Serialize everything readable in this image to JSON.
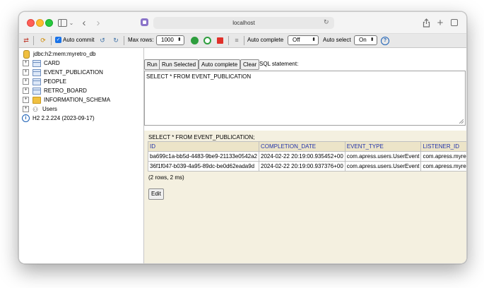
{
  "browser": {
    "url": "localhost"
  },
  "toolbar": {
    "auto_commit_label": "Auto commit",
    "max_rows_label": "Max rows:",
    "max_rows_value": "1000",
    "auto_complete_label": "Auto complete",
    "auto_complete_value": "Off",
    "auto_select_label": "Auto select",
    "auto_select_value": "On",
    "help_glyph": "?"
  },
  "tree": {
    "connection": "jdbc:h2:mem:myretro_db",
    "items": [
      {
        "label": "CARD",
        "icon": "table-icon"
      },
      {
        "label": "EVENT_PUBLICATION",
        "icon": "table-icon"
      },
      {
        "label": "PEOPLE",
        "icon": "table-icon"
      },
      {
        "label": "RETRO_BOARD",
        "icon": "table-icon"
      },
      {
        "label": "INFORMATION_SCHEMA",
        "icon": "folder-icon"
      },
      {
        "label": "Users",
        "icon": "users-icon"
      }
    ],
    "version": "H2 2.2.224 (2023-09-17)"
  },
  "query": {
    "run": "Run",
    "run_selected": "Run Selected",
    "auto_complete": "Auto complete",
    "clear": "Clear",
    "sql_label": "SQL statement:",
    "sql_text": "SELECT * FROM EVENT_PUBLICATION"
  },
  "result": {
    "statement": "SELECT * FROM EVENT_PUBLICATION;",
    "columns": [
      "ID",
      "COMPLETION_DATE",
      "EVENT_TYPE",
      "LISTENER_ID"
    ],
    "rows": [
      [
        "ba699c1a-bb5d-4483-9be9-21133e0542a2",
        "2024-02-22 20:19:00.935452+00",
        "com.apress.users.UserEvent",
        "com.apress.myretro"
      ],
      [
        "36f1f047-b039-4a95-89dc-be0d62eada9d",
        "2024-02-22 20:19:00.937376+00",
        "com.apress.users.UserEvent",
        "com.apress.myretro"
      ]
    ],
    "row_count": "(2 rows, 2 ms)",
    "edit": "Edit"
  }
}
